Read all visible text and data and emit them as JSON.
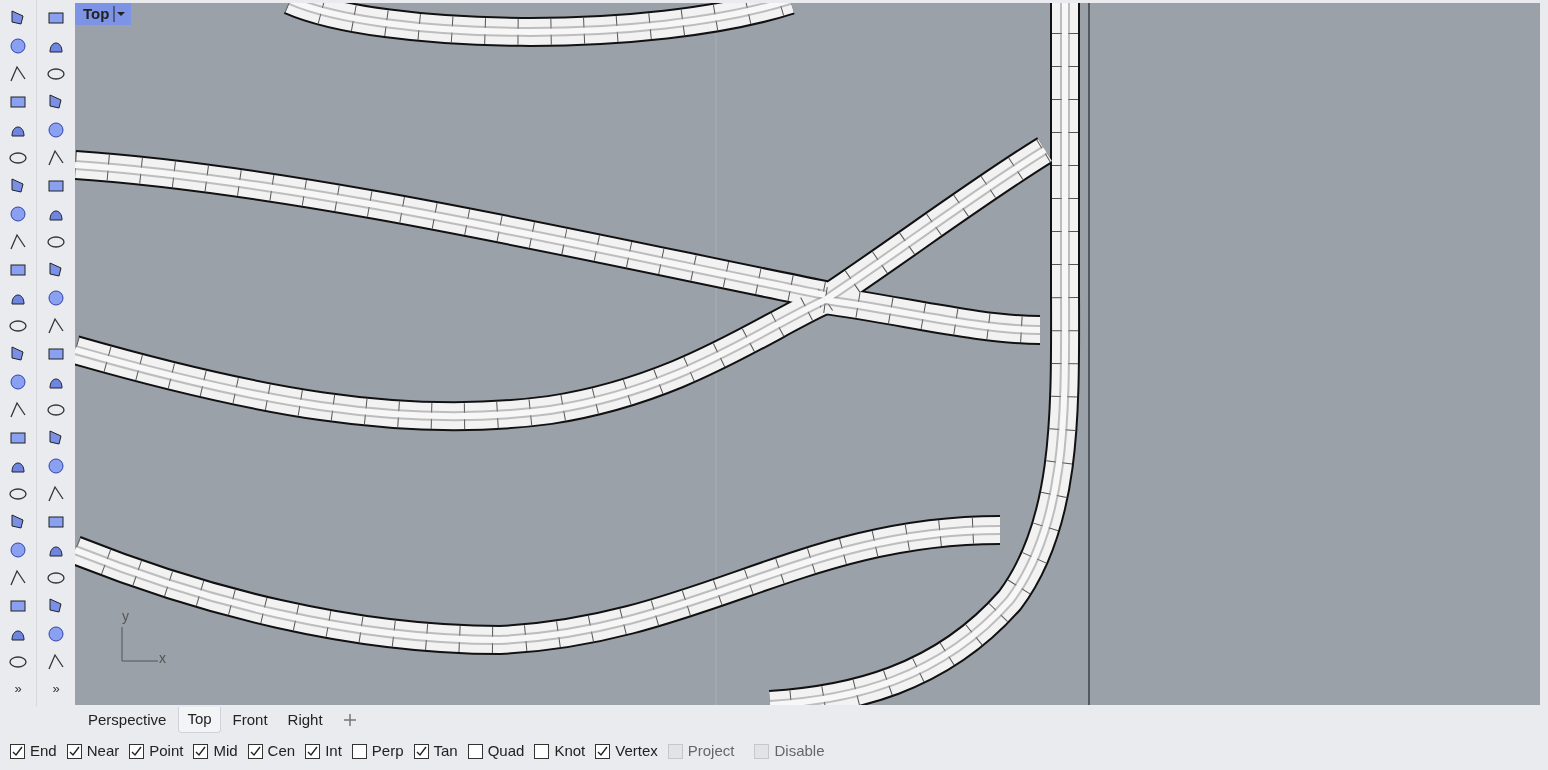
{
  "toolbars": {
    "overflow_left": "»",
    "overflow_right": "»"
  },
  "viewport": {
    "title": "Top",
    "axis_x": "x",
    "axis_y": "y"
  },
  "viewport_tabs": [
    {
      "label": "Perspective",
      "selected": false
    },
    {
      "label": "Top",
      "selected": true
    },
    {
      "label": "Front",
      "selected": false
    },
    {
      "label": "Right",
      "selected": false
    }
  ],
  "osnaps": [
    {
      "label": "End",
      "checked": true,
      "disabled": false
    },
    {
      "label": "Near",
      "checked": true,
      "disabled": false
    },
    {
      "label": "Point",
      "checked": true,
      "disabled": false
    },
    {
      "label": "Mid",
      "checked": true,
      "disabled": false
    },
    {
      "label": "Cen",
      "checked": true,
      "disabled": false
    },
    {
      "label": "Int",
      "checked": true,
      "disabled": false
    },
    {
      "label": "Perp",
      "checked": false,
      "disabled": false
    },
    {
      "label": "Tan",
      "checked": true,
      "disabled": false
    },
    {
      "label": "Quad",
      "checked": false,
      "disabled": false
    },
    {
      "label": "Knot",
      "checked": false,
      "disabled": false
    },
    {
      "label": "Vertex",
      "checked": true,
      "disabled": false
    },
    {
      "label": "Project",
      "checked": false,
      "disabled": true
    },
    {
      "label": "Disable",
      "checked": false,
      "disabled": true
    }
  ]
}
